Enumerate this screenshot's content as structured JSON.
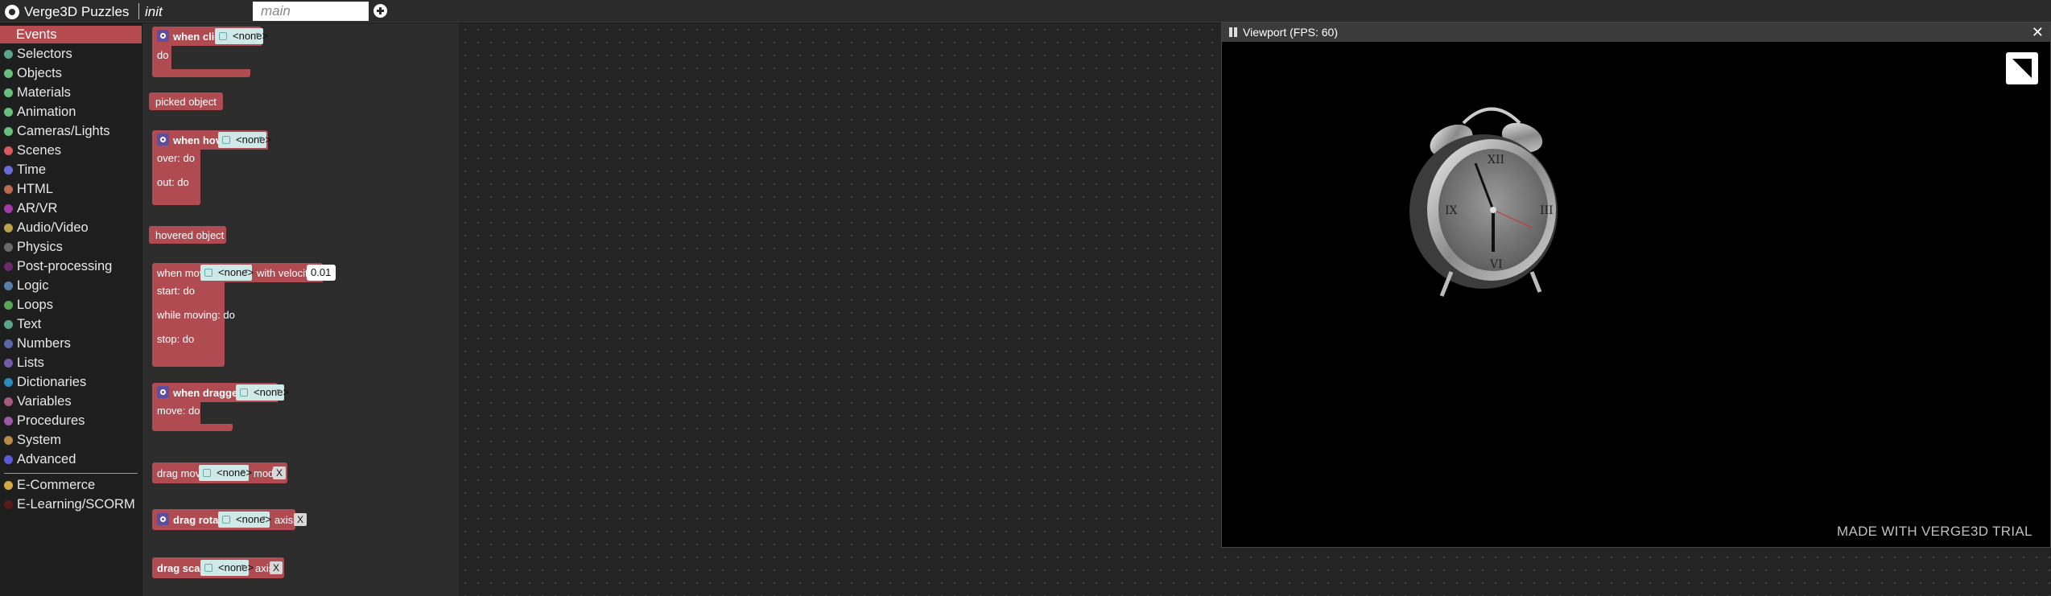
{
  "app": {
    "title": "Verge3D Puzzles"
  },
  "tabs": {
    "init": "init",
    "main": "main"
  },
  "sidebar": {
    "categories": [
      {
        "label": "Events",
        "color": "#b54a50"
      },
      {
        "label": "Selectors",
        "color": "#5ba58c"
      },
      {
        "label": "Objects",
        "color": "#6bbf7e"
      },
      {
        "label": "Materials",
        "color": "#6bbf7e"
      },
      {
        "label": "Animation",
        "color": "#6bbf7e"
      },
      {
        "label": "Cameras/Lights",
        "color": "#6bbf7e"
      },
      {
        "label": "Scenes",
        "color": "#d65b60"
      },
      {
        "label": "Time",
        "color": "#6a6adb"
      },
      {
        "label": "HTML",
        "color": "#b96a4f"
      },
      {
        "label": "AR/VR",
        "color": "#a23aa8"
      },
      {
        "label": "Audio/Video",
        "color": "#b9a24a"
      },
      {
        "label": "Physics",
        "color": "#6a6a6a"
      },
      {
        "label": "Post-processing",
        "color": "#6b2b6b"
      },
      {
        "label": "Logic",
        "color": "#5b80a5"
      },
      {
        "label": "Loops",
        "color": "#5ba55b"
      },
      {
        "label": "Text",
        "color": "#5ba58c"
      },
      {
        "label": "Numbers",
        "color": "#5b67a5"
      },
      {
        "label": "Lists",
        "color": "#745ba5"
      },
      {
        "label": "Dictionaries",
        "color": "#2b8cba"
      },
      {
        "label": "Variables",
        "color": "#a55b80"
      },
      {
        "label": "Procedures",
        "color": "#995ba5"
      },
      {
        "label": "System",
        "color": "#b98a4a"
      },
      {
        "label": "Advanced",
        "color": "#5b5bd6"
      },
      {
        "label": "E-Commerce",
        "color": "#d4a84a"
      },
      {
        "label": "E-Learning/SCORM",
        "color": "#5a1a1a"
      }
    ]
  },
  "blocks": {
    "when_clicked": "when clicked",
    "do": "do",
    "none": "<none>",
    "picked_object": "picked object",
    "when_hovered": "when hovered",
    "over_do": "over: do",
    "out_do": "out: do",
    "hovered_object": "hovered object",
    "when_moved": "when moved",
    "with_velocity": "with velocity >",
    "velocity_value": "0.01",
    "start_do": "start: do",
    "while_moving_do": "while moving: do",
    "stop_do": "stop: do",
    "when_dragged_over": "when dragged over",
    "move_do": "move: do",
    "drag_move": "drag move",
    "mode": "mode",
    "drag_rotate": "drag rotate",
    "drag_scale": "drag scale",
    "axis": "axis",
    "axis_x": "X"
  },
  "viewport": {
    "title": "Viewport (FPS: 60)",
    "close": "✕",
    "watermark": "MADE WITH VERGE3D TRIAL"
  }
}
